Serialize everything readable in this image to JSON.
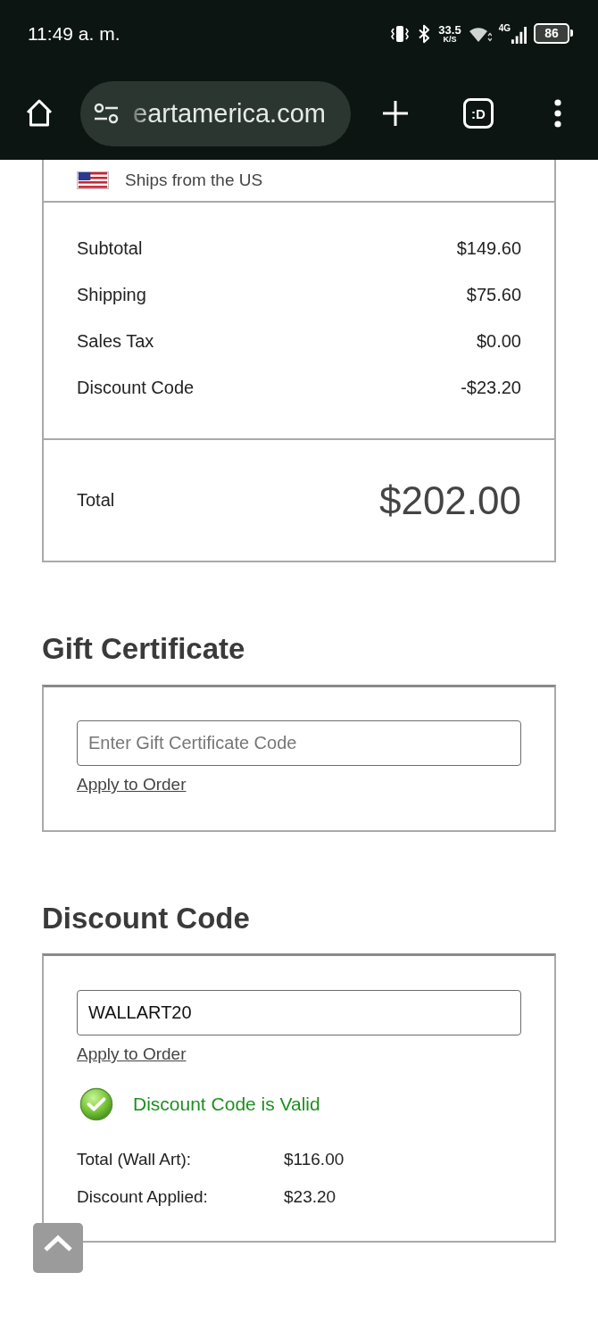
{
  "status_bar": {
    "time": "11:49 a. m.",
    "net_speed": "33.5",
    "net_speed_unit": "K/S",
    "network_type": "4G",
    "battery": "86"
  },
  "browser": {
    "url": "eartamerica.com",
    "tab_count": ":D"
  },
  "order_summary": {
    "shipping_note": "Ships from the US",
    "rows": [
      {
        "label": "Subtotal",
        "value": "$149.60"
      },
      {
        "label": "Shipping",
        "value": "$75.60"
      },
      {
        "label": "Sales Tax",
        "value": "$0.00"
      },
      {
        "label": "Discount Code",
        "value": "-$23.20"
      }
    ],
    "total": {
      "label": "Total",
      "value": "$202.00"
    }
  },
  "gift_certificate": {
    "title": "Gift Certificate",
    "field": {
      "placeholder": "Enter Gift Certificate Code"
    },
    "link": "Apply to Order"
  },
  "discount_code": {
    "title": "Discount Code",
    "field": {
      "value": "WALLART20"
    },
    "link": "Apply to Order",
    "status": {
      "kind": "valid",
      "message": "Discount Code is Valid"
    },
    "details": [
      {
        "label": "Total (Wall Art):",
        "value": "$116.00"
      },
      {
        "label": "Discount Applied:",
        "value": "$23.20"
      }
    ]
  }
}
